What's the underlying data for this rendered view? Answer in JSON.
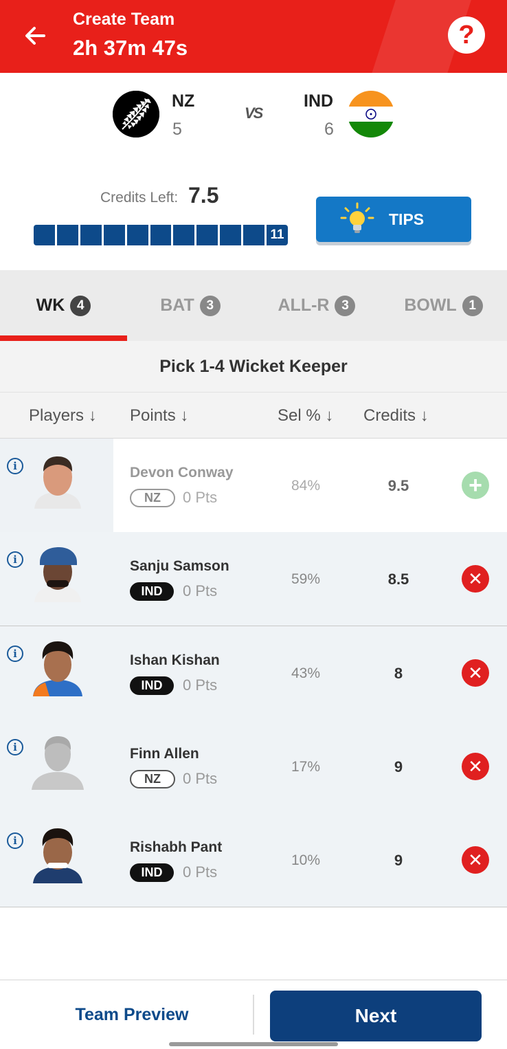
{
  "header": {
    "title": "Create Team",
    "timer": "2h 37m 47s",
    "help_label": "?",
    "colors": {
      "primary": "#e8201a"
    }
  },
  "match": {
    "team1": {
      "code": "NZ",
      "count": "5"
    },
    "vs": "VS",
    "team2": {
      "code": "IND",
      "count": "6"
    }
  },
  "credits": {
    "label": "Credits Left:",
    "value": "7.5",
    "selected_count": "11",
    "selection_total": 11
  },
  "tips_label": "TIPS",
  "tabs": [
    {
      "label": "WK",
      "count": "4",
      "active": true
    },
    {
      "label": "BAT",
      "count": "3",
      "active": false
    },
    {
      "label": "ALL-R",
      "count": "3",
      "active": false
    },
    {
      "label": "BOWL",
      "count": "1",
      "active": false
    }
  ],
  "pick_title": "Pick 1-4 Wicket Keeper",
  "columns": {
    "players": "Players ↓",
    "points": "Points ↓",
    "sel": "Sel % ↓",
    "credits": "Credits ↓"
  },
  "players": [
    {
      "name": "Devon Conway",
      "team": "NZ",
      "points": "0 Pts",
      "sel": "84%",
      "credits": "9.5",
      "selected": false
    },
    {
      "name": "Sanju Samson",
      "team": "IND",
      "points": "0 Pts",
      "sel": "59%",
      "credits": "8.5",
      "selected": true
    },
    {
      "name": "Ishan Kishan",
      "team": "IND",
      "points": "0 Pts",
      "sel": "43%",
      "credits": "8",
      "selected": true
    },
    {
      "name": "Finn Allen",
      "team": "NZ",
      "points": "0 Pts",
      "sel": "17%",
      "credits": "9",
      "selected": true
    },
    {
      "name": "Rishabh Pant",
      "team": "IND",
      "points": "0 Pts",
      "sel": "10%",
      "credits": "9",
      "selected": true
    }
  ],
  "footer": {
    "team_preview": "Team Preview",
    "next": "Next"
  },
  "icons": {
    "back": "arrow-left-icon",
    "help": "question-icon",
    "info": "info-icon",
    "add": "plus-icon",
    "remove": "close-icon",
    "bulb": "lightbulb-icon"
  }
}
